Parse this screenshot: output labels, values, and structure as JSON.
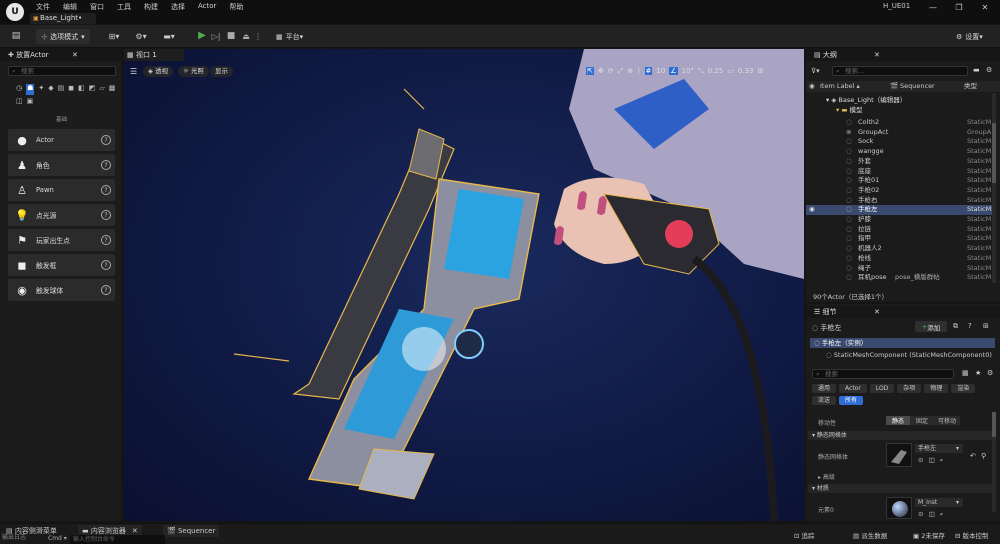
{
  "app": {
    "logo_text": "U",
    "menus": [
      "文件",
      "编辑",
      "窗口",
      "工具",
      "构建",
      "选择",
      "Actor",
      "帮助"
    ],
    "document_tab": "Base_Light•",
    "project_title": "H_UE01",
    "window_controls": [
      "—",
      "❐",
      "✕"
    ]
  },
  "toolbar": {
    "mode_label": "选项模式",
    "platform_label": "平台",
    "settings_label": "设置"
  },
  "place_actors": {
    "title": "放置Actor",
    "search_placeholder": "搜索",
    "category_label": "基础",
    "items": [
      {
        "label": "Actor",
        "icon": "sphere-icon"
      },
      {
        "label": "角色",
        "icon": "character-icon"
      },
      {
        "label": "Pawn",
        "icon": "pawn-icon"
      },
      {
        "label": "点光源",
        "icon": "point-light-icon"
      },
      {
        "label": "玩家出生点",
        "icon": "player-start-icon"
      },
      {
        "label": "触发框",
        "icon": "trigger-box-icon"
      },
      {
        "label": "触发球体",
        "icon": "trigger-sphere-icon"
      }
    ]
  },
  "viewport": {
    "tab_label": "视口 1",
    "perspective_label": "透视",
    "lit_label": "光照",
    "show_label": "显示",
    "grid_snap": "10",
    "rotation_snap": "10°",
    "scale_snap": "0.25",
    "camera_speed": "0.33"
  },
  "outliner": {
    "title": "大纲",
    "search_placeholder": "搜索...",
    "col_item_label": "Item Label ▴",
    "col_sequencer": "Sequencer",
    "col_type": "类型",
    "root_label": "Base_Light（编辑器）",
    "folder_label": "模型",
    "rows": [
      {
        "name": "Colth2",
        "type": "StaticM"
      },
      {
        "name": "GroupAct",
        "type": "GroupA"
      },
      {
        "name": "Sock",
        "type": "StaticM"
      },
      {
        "name": "wangge",
        "type": "StaticM"
      },
      {
        "name": "外套",
        "type": "StaticM"
      },
      {
        "name": "底座",
        "type": "StaticM"
      },
      {
        "name": "手枪01",
        "type": "StaticM"
      },
      {
        "name": "手枪02",
        "type": "StaticM"
      },
      {
        "name": "手枪右",
        "type": "StaticM"
      },
      {
        "name": "手枪左",
        "type": "StaticM",
        "selected": true
      },
      {
        "name": "护膝",
        "type": "StaticM"
      },
      {
        "name": "拉链",
        "type": "StaticM"
      },
      {
        "name": "指甲",
        "type": "StaticM"
      },
      {
        "name": "机器人2",
        "type": "StaticM"
      },
      {
        "name": "枪线",
        "type": "StaticM"
      },
      {
        "name": "绳子",
        "type": "StaticM"
      },
      {
        "name": "耳机pose",
        "extra": "pose_横版群帖",
        "type": "StaticM"
      }
    ],
    "footer": "90个Actor（已选择1个）"
  },
  "details": {
    "title": "细节",
    "object_name": "手枪左",
    "add_label": "添加",
    "instance_label": "手枪左（实例）",
    "component_label": "StaticMeshComponent (StaticMeshComponent0)",
    "search_placeholder": "搜索",
    "categories": [
      "通用",
      "Actor",
      "LOD",
      "杂项",
      "物理",
      "渲染",
      "流送",
      "所有"
    ],
    "mobility_label": "移动性",
    "mobility_options": [
      "静态",
      "固定",
      "可移动"
    ],
    "section_static_mesh": "静态网格体",
    "static_mesh_prop": "静态网格体",
    "static_mesh_value": "手枪左",
    "section_advanced": "高级",
    "section_materials": "材质",
    "element_label": "元素0",
    "material_value": "M_Inst"
  },
  "bottom": {
    "tabs": [
      "内容侧滑菜单",
      "内容浏览器",
      "Sequencer"
    ],
    "tab_overlay": "输出日志",
    "cmd_label": "Cmd ▾",
    "console_placeholder": "输入控制台命令",
    "trace_label": "追踪",
    "derived_data_label": "派生数据",
    "unsaved_label": "2未保存",
    "version_label": "版本控制"
  }
}
